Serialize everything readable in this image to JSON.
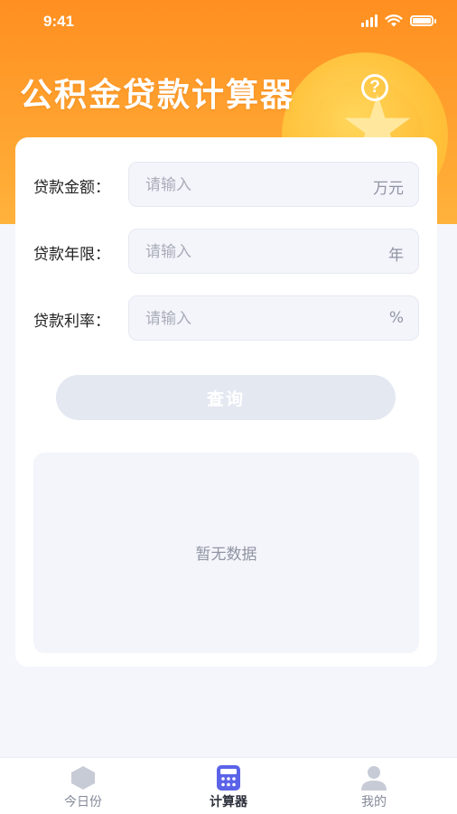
{
  "status_bar": {
    "time": "9:41"
  },
  "header": {
    "title": "公积金贷款计算器",
    "help_icon": "question-circle-icon"
  },
  "form": {
    "fields": [
      {
        "label": "贷款金额：",
        "placeholder": "请输入",
        "value": "",
        "unit": "万元"
      },
      {
        "label": "贷款年限：",
        "placeholder": "请输入",
        "value": "",
        "unit": "年"
      },
      {
        "label": "贷款利率：",
        "placeholder": "请输入",
        "value": "",
        "unit": "%"
      }
    ],
    "query_label": "查询"
  },
  "result": {
    "empty_text": "暂无数据"
  },
  "tabbar": {
    "tabs": [
      {
        "label": "今日份",
        "icon": "moon-icon",
        "active": false
      },
      {
        "label": "计算器",
        "icon": "calculator-icon",
        "active": true
      },
      {
        "label": "我的",
        "icon": "user-icon",
        "active": false
      }
    ]
  },
  "colors": {
    "accent": "#ff9a28",
    "active_tab_icon": "#5b63e8",
    "inactive_tab_icon": "#c7cbd6"
  }
}
